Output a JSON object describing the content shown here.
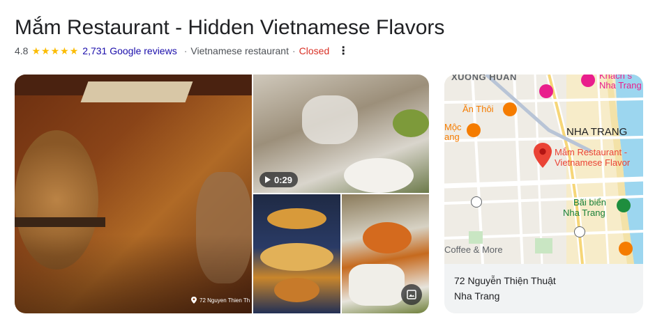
{
  "header": {
    "title": "Mắm Restaurant - Hidden Vietnamese Flavors",
    "rating": "4.8",
    "stars": [
      "★",
      "★",
      "★",
      "★",
      "★"
    ],
    "reviews_label": "2,731 Google reviews",
    "separator": "·",
    "category": "Vietnamese restaurant",
    "status": "Closed",
    "more_icon": "⋮"
  },
  "gallery": {
    "main_photo_address": "72 Nguyen Thien Th",
    "video_duration": "0:29"
  },
  "map": {
    "labels": {
      "xuong_huan": "XUONG HUAN",
      "khach_s": "Khách s",
      "nha_trang_top": "Nha Trang",
      "an_thoi": "Ăn Thôi",
      "moc": "Mộc",
      "ang": "ang",
      "nha_trang": "NHA TRANG",
      "pin_label_1": "Mắm Restaurant -",
      "pin_label_2": "Vietnamese Flavor",
      "beach_1": "Bãi biển",
      "beach_2": "Nha Trang",
      "coffee": "Coffee & More"
    },
    "address_line1": "72 Nguyễn Thiện Thuật",
    "address_line2": "Nha Trang"
  },
  "colors": {
    "star": "#fbbc04",
    "link": "#1a0dab",
    "closed": "#d93025",
    "pin": "#ea4335",
    "map_green": "#34a853",
    "map_pink": "#e91e8c",
    "map_orange": "#f57c00"
  }
}
